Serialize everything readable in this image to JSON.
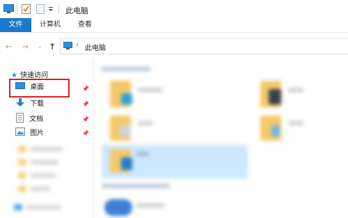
{
  "window": {
    "title": "此电脑",
    "icons": [
      "computer-icon",
      "properties-icon",
      "new-folder-icon",
      "dropdown-icon"
    ]
  },
  "ribbon": {
    "tabs": [
      {
        "label": "文件",
        "active": true
      },
      {
        "label": "计算机",
        "active": false
      },
      {
        "label": "查看",
        "active": false
      }
    ]
  },
  "address": {
    "path": "此电脑",
    "icons": [
      "back-icon",
      "forward-icon",
      "recent-dropdown-icon",
      "up-icon",
      "computer-icon"
    ]
  },
  "nav": {
    "quick_access": "快速访问",
    "items": [
      {
        "label": "桌面",
        "icon": "desktop-icon",
        "pinned": true,
        "highlighted": true
      },
      {
        "label": "下载",
        "icon": "download-icon",
        "pinned": true
      },
      {
        "label": "文档",
        "icon": "document-icon",
        "pinned": true
      },
      {
        "label": "图片",
        "icon": "picture-icon",
        "pinned": true
      }
    ]
  },
  "colors": {
    "accent": "#1979ca",
    "highlight_border": "#d61f26",
    "folder": "#f5c86a",
    "selection": "#cce8ff"
  }
}
